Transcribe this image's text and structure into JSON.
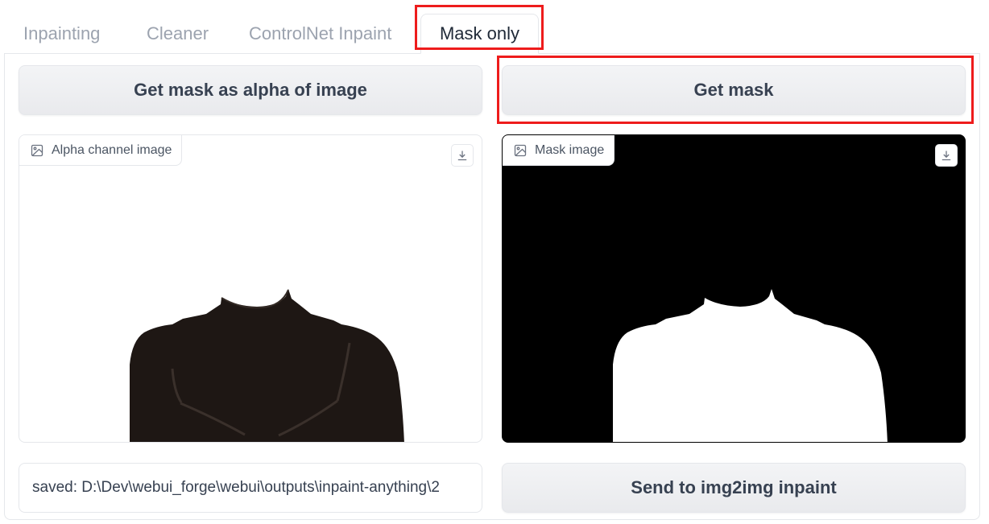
{
  "tabs": [
    {
      "label": "Inpainting",
      "active": false
    },
    {
      "label": "Cleaner",
      "active": false
    },
    {
      "label": "ControlNet Inpaint",
      "active": false
    },
    {
      "label": "Mask only",
      "active": true
    }
  ],
  "left": {
    "button_label": "Get mask as alpha of image",
    "image_label": "Alpha channel image",
    "status_value": "saved: D:\\Dev\\webui_forge\\webui\\outputs\\inpaint-anything\\2"
  },
  "right": {
    "button_label": "Get mask",
    "image_label": "Mask image",
    "send_label": "Send to img2img inpaint"
  },
  "icons": {
    "image": "image-icon",
    "download": "download-icon"
  },
  "colors": {
    "highlight": "#ee1c1c",
    "garment": "#1e1714",
    "mask_bg": "#000000",
    "mask_fg": "#ffffff"
  }
}
